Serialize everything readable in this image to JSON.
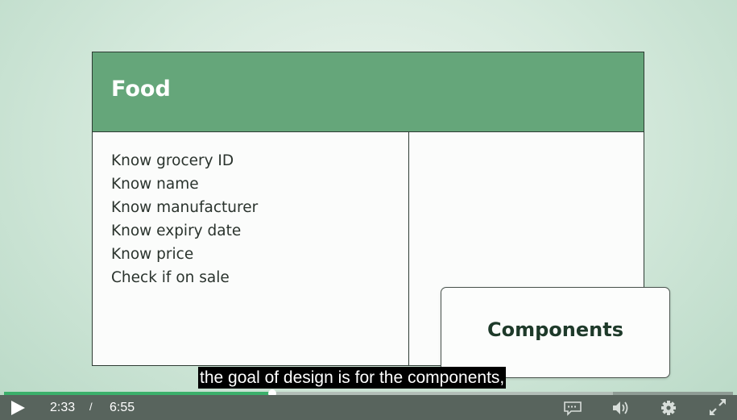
{
  "slide": {
    "card_title": "Food",
    "responsibilities": [
      "Know grocery ID",
      "Know name",
      "Know manufacturer",
      "Know expiry date",
      "Know price",
      "Check if on sale"
    ],
    "collaborator": "Components"
  },
  "caption": "the goal of design is for the components,",
  "player": {
    "current_time": "2:33",
    "separator": "/",
    "duration": "6:55",
    "played_fraction": 0.368,
    "buffered_fraction": 0.835,
    "icons": [
      "play-icon",
      "captions-icon",
      "volume-icon",
      "settings-icon",
      "fullscreen-icon"
    ],
    "colors": {
      "progress": "#3bb06b",
      "bar": "#58645d",
      "header": "#65a67a"
    }
  }
}
